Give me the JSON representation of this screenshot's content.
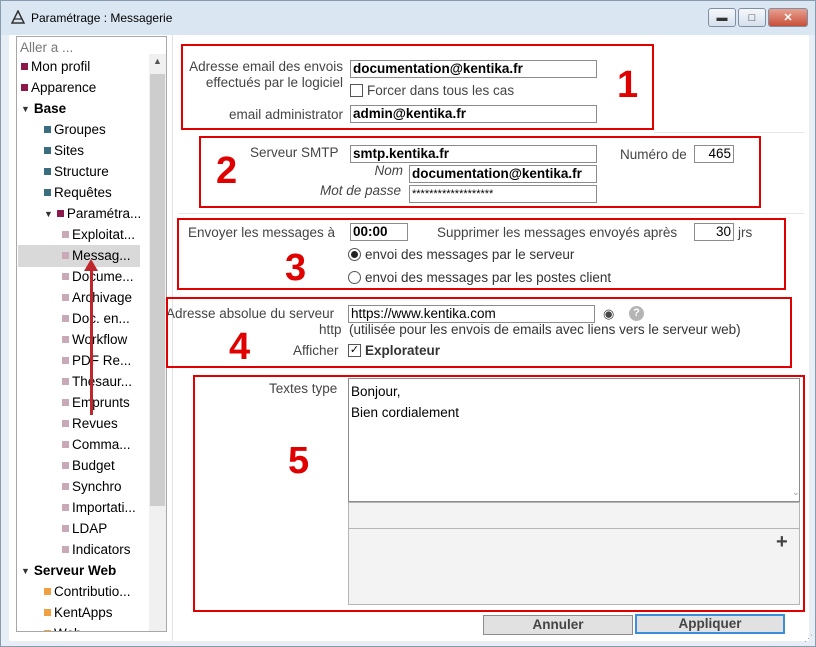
{
  "window": {
    "title": "Paramétrage : Messagerie",
    "minimize_glyph": "▬",
    "maximize_glyph": "□",
    "close_glyph": "✕"
  },
  "sidebar": {
    "goto_placeholder": "Aller a ...",
    "items": [
      {
        "label": "Mon profil",
        "color": "#8b1a4a"
      },
      {
        "label": "Apparence",
        "color": "#8b1a4a"
      },
      {
        "label": "Base",
        "bold": true
      },
      {
        "label": "Groupes",
        "color": "#3a6e7e"
      },
      {
        "label": "Sites",
        "color": "#3a6e7e"
      },
      {
        "label": "Structure",
        "color": "#3a6e7e"
      },
      {
        "label": "Requêtes",
        "color": "#3a6e7e"
      },
      {
        "label": "Paramétra...",
        "color": "#8b1a4a"
      },
      {
        "label": "Exploitat...",
        "color": "#c9a9b8"
      },
      {
        "label": "Messag...",
        "color": "#c9a9b8",
        "selected": true
      },
      {
        "label": "Docume...",
        "color": "#c9a9b8"
      },
      {
        "label": "Archivage",
        "color": "#c9a9b8"
      },
      {
        "label": "Doc. en...",
        "color": "#c9a9b8"
      },
      {
        "label": "Workflow",
        "color": "#c9a9b8"
      },
      {
        "label": "PDF Re...",
        "color": "#c9a9b8"
      },
      {
        "label": "Thesaur...",
        "color": "#c9a9b8"
      },
      {
        "label": "Emprunts",
        "color": "#c9a9b8"
      },
      {
        "label": "Revues",
        "color": "#c9a9b8"
      },
      {
        "label": "Comma...",
        "color": "#c9a9b8"
      },
      {
        "label": "Budget",
        "color": "#c9a9b8"
      },
      {
        "label": "Synchro",
        "color": "#c9a9b8"
      },
      {
        "label": "Importati...",
        "color": "#c9a9b8"
      },
      {
        "label": "LDAP",
        "color": "#c9a9b8"
      },
      {
        "label": "Indicators",
        "color": "#c9a9b8"
      },
      {
        "label": "Serveur Web",
        "bold": true
      },
      {
        "label": "Contributio...",
        "color": "#f0a040"
      },
      {
        "label": "KentApps",
        "color": "#f0a040"
      },
      {
        "label": "Web ...",
        "color": "#f0a040"
      }
    ]
  },
  "section1": {
    "number": "1",
    "sender_label": "Adresse email des envois effectués par le logiciel",
    "sender_value": "documentation@kentika.fr",
    "force_label": "Forcer dans tous les cas",
    "force_checked": false,
    "admin_label": "email administrator",
    "admin_value": "admin@kentika.fr"
  },
  "section2": {
    "number": "2",
    "smtp_label": "Serveur SMTP",
    "smtp_value": "smtp.kentika.fr",
    "port_label": "Numéro de",
    "port_value": "465",
    "name_label": "Nom",
    "name_value": "documentation@kentika.fr",
    "password_label": "Mot de passe",
    "password_value": "*******************"
  },
  "section3": {
    "number": "3",
    "send_label": "Envoyer les messages à",
    "send_value": "00:00",
    "delete_label": "Supprimer les messages envoyés après",
    "delete_value": "30",
    "delete_unit": "jrs",
    "radio_server": "envoi des messages par le serveur",
    "radio_client": "envoi des messages par les postes client",
    "selected_option": "server"
  },
  "section4": {
    "number": "4",
    "url_label": "Adresse absolue du serveur",
    "url_value": "https://www.kentika.com",
    "http_label": "http",
    "hint": "(utilisée pour les envois de emails avec liens vers le serveur web)",
    "show_label": "Afficher",
    "explorer_label": "Explorateur",
    "explorer_checked": true,
    "eye_glyph": "◉",
    "help_glyph": "?"
  },
  "section5": {
    "number": "5",
    "label": "Textes type",
    "line1": "Bonjour,",
    "line2": "Bien cordialement",
    "add_glyph": "+"
  },
  "footer": {
    "cancel": "Annuler",
    "apply": "Appliquer"
  }
}
